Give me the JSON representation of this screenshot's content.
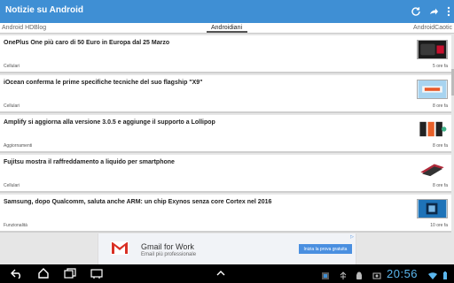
{
  "appbar": {
    "title": "Notizie su Android",
    "refresh_icon": "refresh-icon",
    "share_icon": "share-icon",
    "overflow_icon": "overflow-menu-icon",
    "color": "#3f8fd4"
  },
  "tabs": {
    "left": "Android HDBlog",
    "active": "Androidiani",
    "right": "AndroidCaotic"
  },
  "articles": [
    {
      "title": "OnePlus One più caro di 50 Euro in Europa dal 25 Marzo",
      "category": "Cellulari",
      "time": "5 ore fa"
    },
    {
      "title": "iOcean conferma le prime specifiche tecniche del suo flagship \"X9\"",
      "category": "Cellulari",
      "time": "8 ore fa"
    },
    {
      "title": "Amplify si aggiorna alla versione 3.0.5 e aggiunge il supporto a Lollipop",
      "category": "Aggiornamenti",
      "time": "8 ore fa"
    },
    {
      "title": "Fujitsu mostra il raffreddamento a liquido per smartphone",
      "category": "Cellulari",
      "time": "8 ore fa"
    },
    {
      "title": "Samsung, dopo Qualcomm, saluta anche ARM: un chip Exynos senza core Cortex nel 2016",
      "category": "Funzionalità",
      "time": "10 ore fa"
    }
  ],
  "ad": {
    "brand": "Gmail for Work",
    "subtitle": "Email più professionale",
    "cta": "Inizia la prova gratuita",
    "badge": "▷"
  },
  "statusbar": {
    "clock": "20:56"
  }
}
